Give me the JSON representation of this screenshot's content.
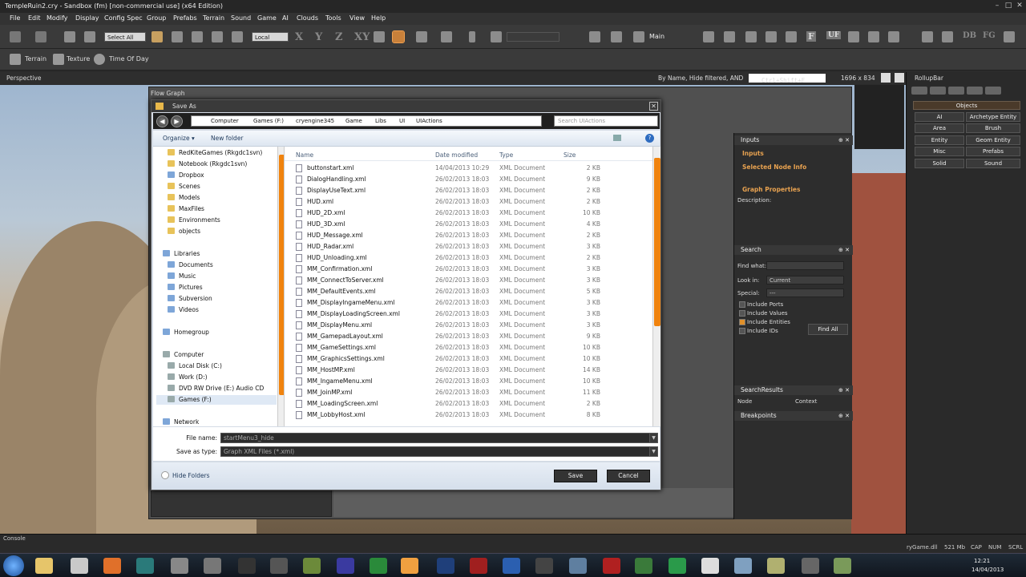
{
  "window": {
    "title": "TempleRuin2.cry - Sandbox (fm) [non-commercial use] (x64 Edition)"
  },
  "menu": [
    "File",
    "Edit",
    "Modify",
    "Display",
    "Config Spec",
    "Group",
    "Prefabs",
    "Terrain",
    "Sound",
    "Game",
    "AI",
    "Clouds",
    "Tools",
    "View",
    "Help"
  ],
  "toolbar": {
    "select_all": "Select All",
    "coord_system": "Local",
    "axis_x": "X",
    "axis_y": "Y",
    "axis_z": "Z",
    "axis_xy": "XY",
    "layer": "Main",
    "letters": [
      "F",
      "UF",
      "DB",
      "FG"
    ]
  },
  "toolbar2": {
    "terrain": "Terrain",
    "texture": "Texture",
    "time_of_day": "Time Of Day"
  },
  "viewport": {
    "label": "Perspective",
    "filter_text": "By Name, Hide filtered, AND",
    "search_shortcut": "Ctrl+Shift+F",
    "resolution": "1696 x 834"
  },
  "rollupbar": {
    "title": "RollupBar",
    "objects_header": "Objects",
    "buttons": [
      "AI",
      "Archetype Entity",
      "Area",
      "Brush",
      "Entity",
      "Geom Entity",
      "Misc",
      "Prefabs",
      "Solid",
      "Sound"
    ]
  },
  "flowgraph": {
    "title": "Flow Graph",
    "inputs_panel": "Inputs",
    "inputs": "Inputs",
    "selected_node_info": "Selected Node Info",
    "graph_properties": "Graph Properties",
    "description": "Description:",
    "search_panel": "Search",
    "find_what": "Find what:",
    "look_in": "Look in:",
    "look_in_value": "Current",
    "special": "Special:",
    "special_value": "---",
    "include_ports": "Include Ports",
    "include_values": "Include Values",
    "include_entities": "Include Entities",
    "include_ids": "Include IDs",
    "find_all": "Find All",
    "search_results": "SearchResults",
    "col_node": "Node",
    "col_context": "Context",
    "breakpoints": "Breakpoints"
  },
  "save_dialog": {
    "title": "Save As",
    "breadcrumb": [
      "Computer",
      "Games (F:)",
      "cryengine345",
      "Game",
      "Libs",
      "UI",
      "UIActions"
    ],
    "search_placeholder": "Search UIActions",
    "organize": "Organize ▾",
    "new_folder": "New folder",
    "nav": {
      "favorites": [
        "RedKiteGames (Rkgdc1svn)",
        "Notebook (Rkgdc1svn)",
        "Dropbox",
        "Scenes",
        "Models",
        "MaxFiles",
        "Environments",
        "objects"
      ],
      "libraries": "Libraries",
      "library_items": [
        "Documents",
        "Music",
        "Pictures",
        "Subversion",
        "Videos"
      ],
      "homegroup": "Homegroup",
      "computer": "Computer",
      "drives": [
        "Local Disk (C:)",
        "Work (D:)",
        "DVD RW Drive (E:) Audio CD",
        "Games (F:)"
      ],
      "network": "Network"
    },
    "columns": {
      "name": "Name",
      "date": "Date modified",
      "type": "Type",
      "size": "Size"
    },
    "files": [
      {
        "name": "buttonstart.xml",
        "date": "14/04/2013 10:29",
        "type": "XML Document",
        "size": "2 KB"
      },
      {
        "name": "DialogHandling.xml",
        "date": "26/02/2013 18:03",
        "type": "XML Document",
        "size": "9 KB"
      },
      {
        "name": "DisplayUseText.xml",
        "date": "26/02/2013 18:03",
        "type": "XML Document",
        "size": "2 KB"
      },
      {
        "name": "HUD.xml",
        "date": "26/02/2013 18:03",
        "type": "XML Document",
        "size": "2 KB"
      },
      {
        "name": "HUD_2D.xml",
        "date": "26/02/2013 18:03",
        "type": "XML Document",
        "size": "10 KB"
      },
      {
        "name": "HUD_3D.xml",
        "date": "26/02/2013 18:03",
        "type": "XML Document",
        "size": "4 KB"
      },
      {
        "name": "HUD_Message.xml",
        "date": "26/02/2013 18:03",
        "type": "XML Document",
        "size": "2 KB"
      },
      {
        "name": "HUD_Radar.xml",
        "date": "26/02/2013 18:03",
        "type": "XML Document",
        "size": "3 KB"
      },
      {
        "name": "HUD_Unloading.xml",
        "date": "26/02/2013 18:03",
        "type": "XML Document",
        "size": "2 KB"
      },
      {
        "name": "MM_Confirmation.xml",
        "date": "26/02/2013 18:03",
        "type": "XML Document",
        "size": "3 KB"
      },
      {
        "name": "MM_ConnectToServer.xml",
        "date": "26/02/2013 18:03",
        "type": "XML Document",
        "size": "3 KB"
      },
      {
        "name": "MM_DefaultEvents.xml",
        "date": "26/02/2013 18:03",
        "type": "XML Document",
        "size": "5 KB"
      },
      {
        "name": "MM_DisplayIngameMenu.xml",
        "date": "26/02/2013 18:03",
        "type": "XML Document",
        "size": "3 KB"
      },
      {
        "name": "MM_DisplayLoadingScreen.xml",
        "date": "26/02/2013 18:03",
        "type": "XML Document",
        "size": "3 KB"
      },
      {
        "name": "MM_DisplayMenu.xml",
        "date": "26/02/2013 18:03",
        "type": "XML Document",
        "size": "3 KB"
      },
      {
        "name": "MM_GamepadLayout.xml",
        "date": "26/02/2013 18:03",
        "type": "XML Document",
        "size": "9 KB"
      },
      {
        "name": "MM_GameSettings.xml",
        "date": "26/02/2013 18:03",
        "type": "XML Document",
        "size": "10 KB"
      },
      {
        "name": "MM_GraphicsSettings.xml",
        "date": "26/02/2013 18:03",
        "type": "XML Document",
        "size": "10 KB"
      },
      {
        "name": "MM_HostMP.xml",
        "date": "26/02/2013 18:03",
        "type": "XML Document",
        "size": "14 KB"
      },
      {
        "name": "MM_IngameMenu.xml",
        "date": "26/02/2013 18:03",
        "type": "XML Document",
        "size": "10 KB"
      },
      {
        "name": "MM_JoinMP.xml",
        "date": "26/02/2013 18:03",
        "type": "XML Document",
        "size": "11 KB"
      },
      {
        "name": "MM_LoadingScreen.xml",
        "date": "26/02/2013 18:03",
        "type": "XML Document",
        "size": "2 KB"
      },
      {
        "name": "MM_LobbyHost.xml",
        "date": "26/02/2013 18:03",
        "type": "XML Document",
        "size": "8 KB"
      }
    ],
    "file_name_label": "File name:",
    "file_name_value": "startMenu3_hide",
    "save_type_label": "Save as type:",
    "save_type_value": "Graph XML Files (*.xml)",
    "hide_folders": "Hide Folders",
    "save": "Save",
    "cancel": "Cancel"
  },
  "console": {
    "label": "Console"
  },
  "status": {
    "module": "ryGame.dll",
    "memory": "521 Mb",
    "cap": "CAP",
    "num": "NUM",
    "scrl": "SCRL"
  },
  "clock": {
    "time": "12:21",
    "date": "14/04/2013"
  }
}
